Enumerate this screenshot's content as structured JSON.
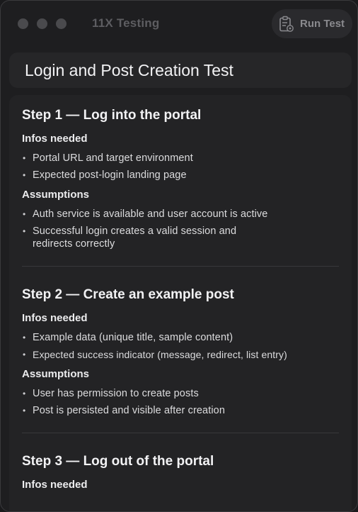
{
  "window": {
    "app_title": "11X Testing"
  },
  "toolbar": {
    "run_label": "Run Test",
    "run_icon": "clipboard-gear-icon"
  },
  "test": {
    "title": "Login and Post Creation Test"
  },
  "steps": [
    {
      "title": "Step 1 — Log into the portal",
      "infos_heading": "Infos needed",
      "infos": [
        "Portal URL and target environment",
        "Expected post-login landing page"
      ],
      "assumptions_heading": "Assumptions",
      "assumptions": [
        "Auth service is available and user account is active",
        "Successful login creates a valid session and redirects correctly"
      ]
    },
    {
      "title": "Step 2 — Create an example post",
      "infos_heading": "Infos needed",
      "infos": [
        "Example data (unique title, sample content)",
        "Expected success indicator (message, redirect, list entry)"
      ],
      "assumptions_heading": "Assumptions",
      "assumptions": [
        "User has permission to create posts",
        "Post is persisted and visible after creation"
      ]
    },
    {
      "title": "Step 3 — Log out of the portal",
      "infos_heading": "Infos needed"
    }
  ]
}
